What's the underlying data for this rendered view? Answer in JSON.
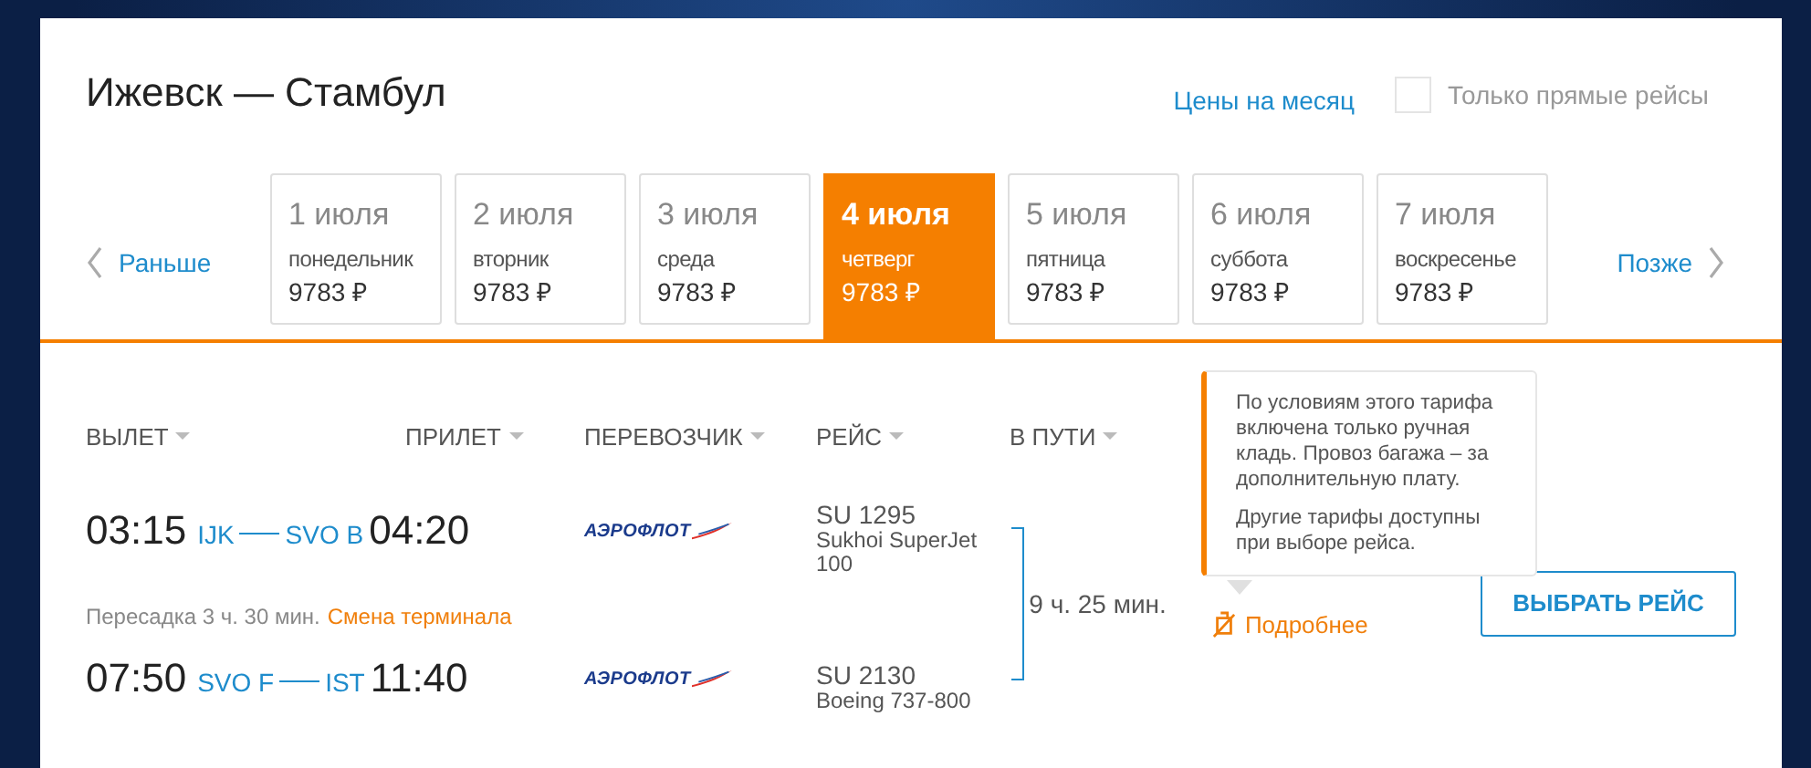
{
  "route_title": "Ижевск — Стамбул",
  "month_prices_link": "Цены на месяц",
  "direct_only": {
    "label": "Только прямые рейсы",
    "checked": false
  },
  "earlier": "Раньше",
  "later": "Позже",
  "dates": [
    {
      "date": "1 июля",
      "weekday": "понедельник",
      "price": "9783 ₽",
      "selected": false
    },
    {
      "date": "2 июля",
      "weekday": "вторник",
      "price": "9783 ₽",
      "selected": false
    },
    {
      "date": "3 июля",
      "weekday": "среда",
      "price": "9783 ₽",
      "selected": false
    },
    {
      "date": "4 июля",
      "weekday": "четверг",
      "price": "9783 ₽",
      "selected": true
    },
    {
      "date": "5 июля",
      "weekday": "пятница",
      "price": "9783 ₽",
      "selected": false
    },
    {
      "date": "6 июля",
      "weekday": "суббота",
      "price": "9783 ₽",
      "selected": false
    },
    {
      "date": "7 июля",
      "weekday": "воскресенье",
      "price": "9783 ₽",
      "selected": false
    }
  ],
  "columns": [
    "ВЫЛЕТ",
    "ПРИЛЕТ",
    "ПЕРЕВОЗЧИК",
    "РЕЙС",
    "В ПУТИ"
  ],
  "segments": [
    {
      "departure_time": "03:15",
      "from": "IJK",
      "to": "SVO B",
      "arrival_time": "04:20",
      "airline": "АЭРОФЛОТ",
      "flight": "SU 1295",
      "aircraft": "Sukhoi SuperJet 100"
    },
    {
      "departure_time": "07:50",
      "from": "SVO F",
      "to": "IST",
      "arrival_time": "11:40",
      "airline": "АЭРОФЛОТ",
      "flight": "SU 2130",
      "aircraft": "Boeing 737-800"
    }
  ],
  "transfer": {
    "text": "Пересадка 3 ч. 30 мин.",
    "warning": "Смена терминала"
  },
  "duration": "9 ч. 25 мин.",
  "details_link": "Подробнее",
  "select_button": "ВЫБРАТЬ РЕЙС",
  "tooltip": [
    "По условиям этого тарифа включена только ручная кладь. Провоз багажа – за дополнительную плату.",
    "Другие тарифы доступны при выборе рейса."
  ]
}
